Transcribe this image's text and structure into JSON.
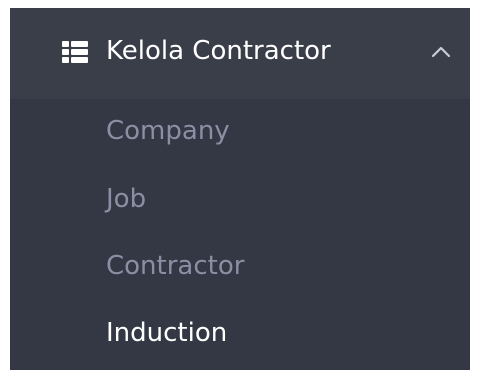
{
  "menu": {
    "title": "Kelola Contractor",
    "icon": "list-icon",
    "toggle_icon": "chevron-up-icon",
    "expanded": true,
    "items": [
      {
        "label": "Company",
        "active": false
      },
      {
        "label": "Job",
        "active": false
      },
      {
        "label": "Contractor",
        "active": false
      },
      {
        "label": "Induction",
        "active": true
      }
    ]
  },
  "colors": {
    "panel": "#333844",
    "header": "#393e49",
    "inactive_text": "#8a8fa3",
    "active_text": "#ffffff"
  }
}
